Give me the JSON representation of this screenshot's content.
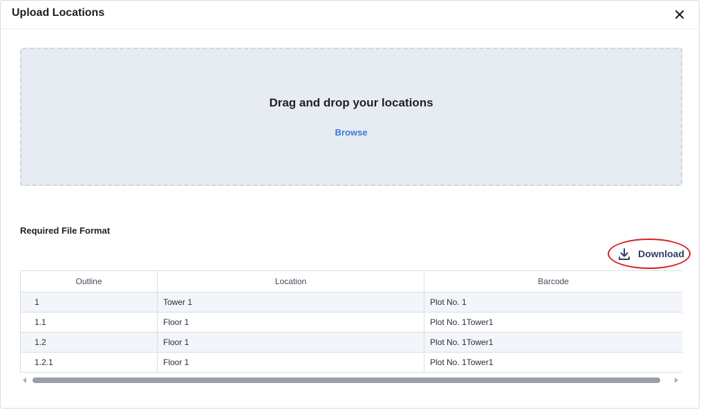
{
  "dialog": {
    "title": "Upload Locations",
    "close_icon": "close-icon"
  },
  "dropzone": {
    "text": "Drag and drop your locations",
    "browse_label": "Browse"
  },
  "format": {
    "label": "Required File Format",
    "download_label": "Download",
    "download_icon": "download-icon"
  },
  "table": {
    "headers": [
      "Outline",
      "Location",
      "Barcode"
    ],
    "rows": [
      [
        "1",
        "Tower 1",
        "Plot No. 1"
      ],
      [
        "1.1",
        "Floor 1",
        "Plot No. 1Tower1"
      ],
      [
        "1.2",
        "Floor 1",
        "Plot No. 1Tower1"
      ],
      [
        "1.2.1",
        "Floor 1",
        "Plot No. 1Tower1"
      ]
    ]
  },
  "colors": {
    "accent": "#3a7ad6",
    "highlight_ring": "#d42020",
    "dropzone_bg": "#e7ecf3"
  }
}
